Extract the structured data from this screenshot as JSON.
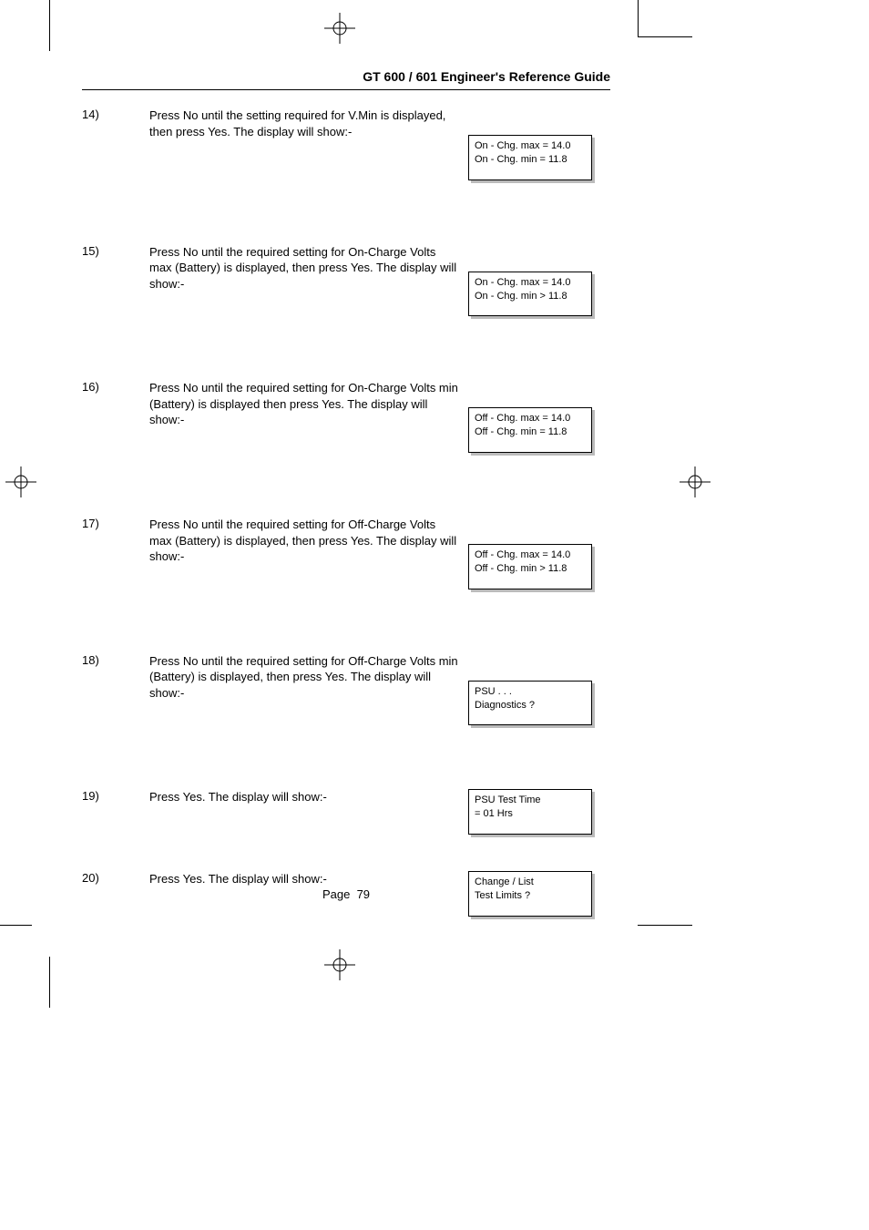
{
  "header": {
    "title": "GT 600 / 601 Engineer's Reference Guide"
  },
  "steps": [
    {
      "num": "14)",
      "text": "Press No until the setting required for V.Min is displayed, then press Yes.\nThe display will show:-",
      "display": {
        "line1": "On - Chg. max = 14.0",
        "line2": "On - Chg. min = 11.8"
      }
    },
    {
      "num": "15)",
      "text": "Press No until the required setting for On-Charge Volts max (Battery) is displayed, then press Yes. The display will show:-",
      "display": {
        "line1": "On - Chg. max = 14.0",
        "line2": "On - Chg. min > 11.8"
      }
    },
    {
      "num": "16)",
      "text": "Press No until the required setting for On-Charge Volts min (Battery) is displayed then press Yes. The display will show:-",
      "display": {
        "line1": "Off - Chg. max = 14.0",
        "line2": "Off - Chg. min = 11.8"
      }
    },
    {
      "num": "17)",
      "text": "Press No until the required setting for Off-Charge Volts max (Battery) is displayed, then press Yes. The display will show:-",
      "display": {
        "line1": "Off - Chg. max = 14.0",
        "line2": "Off - Chg. min > 11.8"
      }
    },
    {
      "num": "18)",
      "text": "Press No until the required setting for Off-Charge Volts min (Battery) is displayed, then press Yes. The display will show:-",
      "display": {
        "line1": "PSU . . .",
        "line2": "Diagnostics ?"
      }
    },
    {
      "num": "19)",
      "text": "Press Yes. The display will show:-",
      "display": {
        "line1": "PSU Test Time",
        "line2": "= 01 Hrs"
      }
    },
    {
      "num": "20)",
      "text": "Press Yes. The display will show:-",
      "display": {
        "line1": "Change / List",
        "line2": "Test Limits ?"
      }
    }
  ],
  "footer": {
    "page_label": "Page",
    "page_number": "79"
  }
}
